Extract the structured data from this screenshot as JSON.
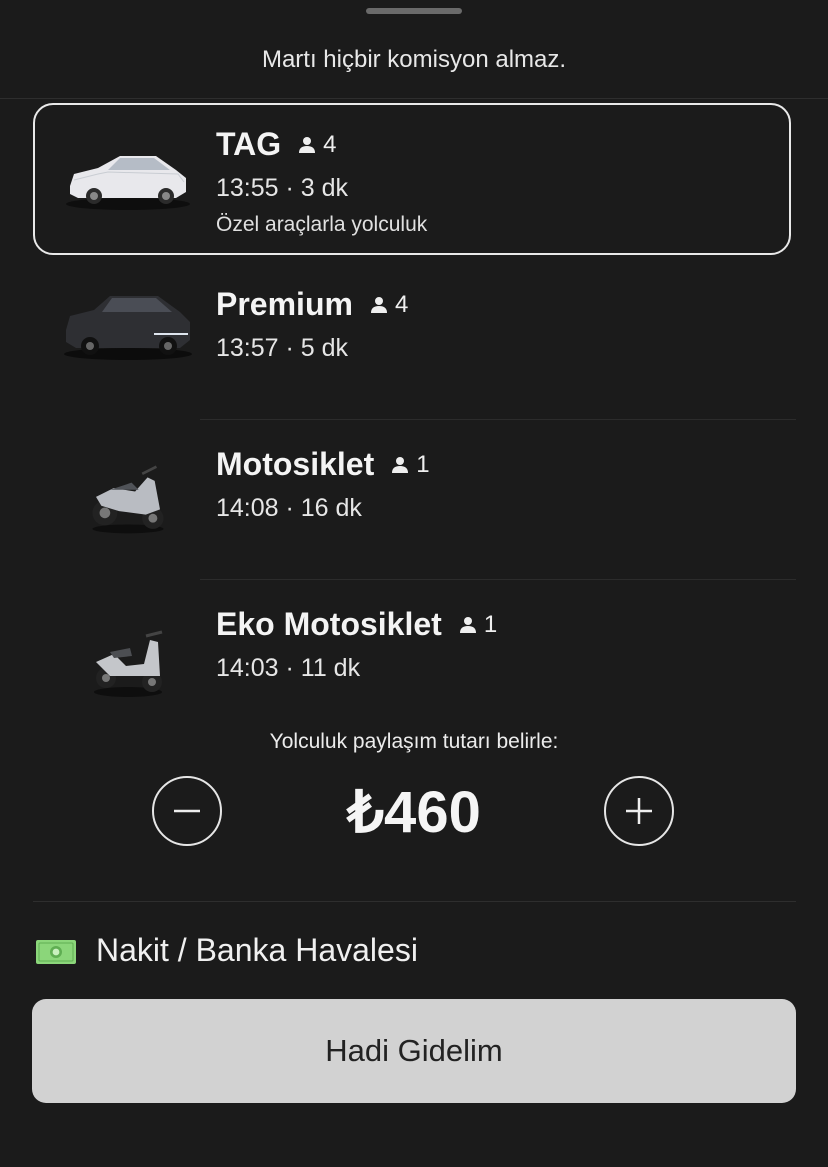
{
  "header": {
    "notice": "Martı hiçbir komisyon almaz."
  },
  "options": [
    {
      "name": "TAG",
      "capacity": "4",
      "time": "13:55 · 3 dk",
      "description": "Özel araçlarla yolculuk",
      "selected": true,
      "vehicle_icon": "white-sedan-icon"
    },
    {
      "name": "Premium",
      "capacity": "4",
      "time": "13:57 · 5 dk",
      "selected": false,
      "vehicle_icon": "black-suv-icon"
    },
    {
      "name": "Motosiklet",
      "capacity": "1",
      "time": "14:08 · 16 dk",
      "selected": false,
      "vehicle_icon": "motorcycle-icon"
    },
    {
      "name": "Eko Motosiklet",
      "capacity": "1",
      "time": "14:03 · 11 dk",
      "selected": false,
      "vehicle_icon": "scooter-icon"
    }
  ],
  "share": {
    "label": "Yolculuk paylaşım tutarı belirle:",
    "amount": "₺460"
  },
  "payment": {
    "label": "Nakit / Banka Havalesi",
    "icon": "cash-icon"
  },
  "action": {
    "label": "Hadi Gidelim"
  },
  "colors": {
    "background": "#1b1b1b",
    "button": "#d2d2d2",
    "cash_green": "#8bd67a"
  }
}
